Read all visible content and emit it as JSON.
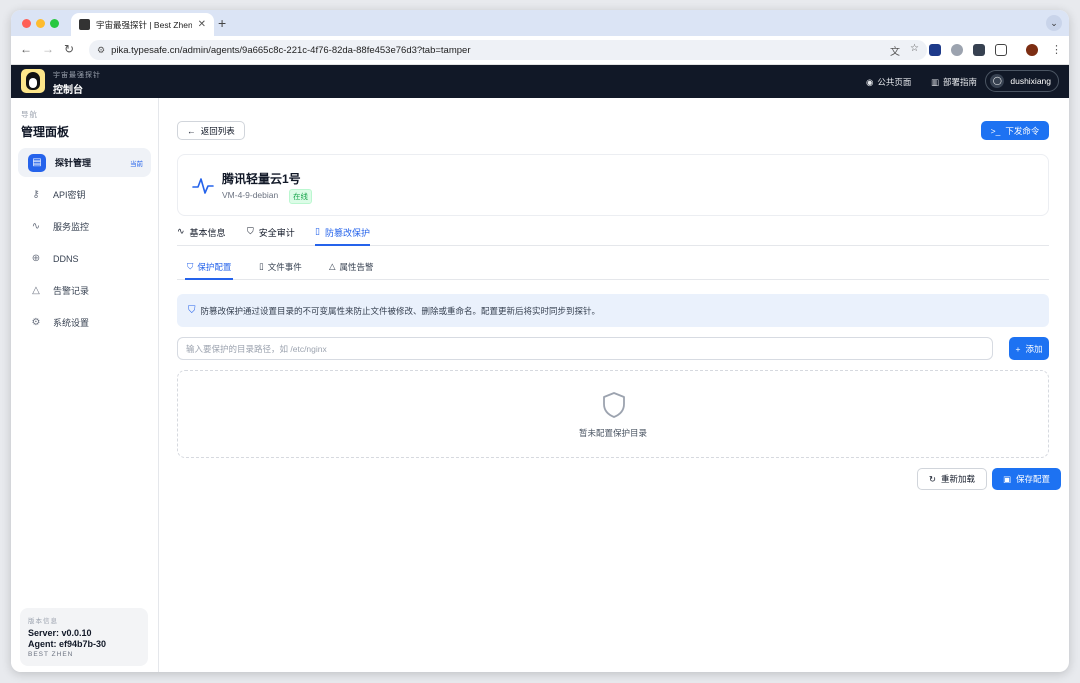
{
  "browser": {
    "tab_title": "宇宙最强探针 | Best Zhen",
    "url": "pika.typesafe.cn/admin/agents/9a665c8c-221c-4f76-82da-88fe453e76d3?tab=tamper"
  },
  "header": {
    "brand_sub": "宇宙最强探针",
    "brand_main": "控制台",
    "public_page": "公共页面",
    "deploy_guide": "部署指南",
    "username": "dushixiang"
  },
  "sidebar": {
    "caption": "导航",
    "title": "管理面板",
    "items": [
      {
        "label": "探针管理",
        "badge": "当前"
      },
      {
        "label": "API密钥"
      },
      {
        "label": "服务监控"
      },
      {
        "label": "DDNS"
      },
      {
        "label": "告警记录"
      },
      {
        "label": "系统设置"
      }
    ],
    "version": {
      "caption": "版本信息",
      "server": "Server: v0.0.10",
      "agent": "Agent: ef94b7b-30",
      "footer": "BEST ZHEN"
    }
  },
  "main": {
    "back_label": "返回列表",
    "command_label": "下发命令",
    "agent": {
      "name": "腾讯轻量云1号",
      "host": "VM-4-9-debian",
      "status": "在线"
    },
    "tabs": [
      "基本信息",
      "安全审计",
      "防篡改保护"
    ],
    "subtabs": [
      "保护配置",
      "文件事件",
      "属性告警"
    ],
    "info_text": "防篡改保护通过设置目录的不可变属性来防止文件被修改、删除或重命名。配置更新后将实时同步到探针。",
    "path_placeholder": "输入要保护的目录路径，如 /etc/nginx",
    "add_label": "添加",
    "empty_text": "暂未配置保护目录",
    "reload_label": "重新加载",
    "save_label": "保存配置"
  },
  "colors": {
    "accent": "#1d72f2",
    "header_bg": "#111827",
    "success": "#16a34a"
  }
}
